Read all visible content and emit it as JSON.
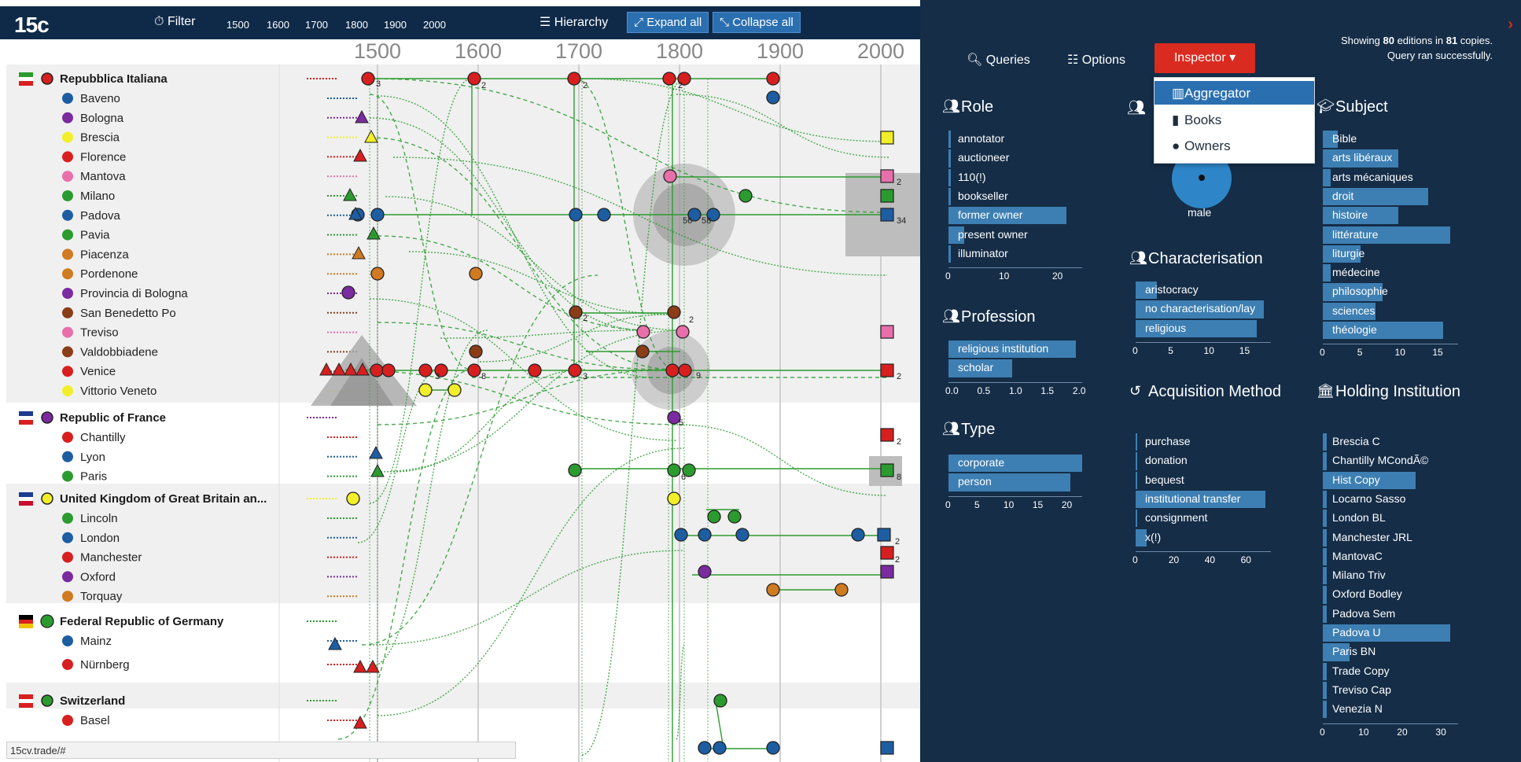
{
  "app": {
    "brand": "15c",
    "filter_label": "Filter",
    "years": [
      "1500",
      "1600",
      "1700",
      "1800",
      "1900",
      "2000"
    ],
    "hierarchy_label": "Hierarchy",
    "expand_all": "Expand all",
    "collapse_all": "Collapse all",
    "status_url": "15cv.trade/#"
  },
  "timeline": {
    "axis_ticks": [
      "1500",
      "1600",
      "1700",
      "1800",
      "1900",
      "2000"
    ]
  },
  "countries": [
    {
      "name": "Repubblica Italiana",
      "color": "#d81f1f",
      "cities": [
        {
          "name": "Baveno",
          "color": "#1d5ea3"
        },
        {
          "name": "Bologna",
          "color": "#7b2aa0"
        },
        {
          "name": "Brescia",
          "color": "#f2ef2a"
        },
        {
          "name": "Florence",
          "color": "#d81f1f"
        },
        {
          "name": "Mantova",
          "color": "#e86faa"
        },
        {
          "name": "Milano",
          "color": "#2c9b2f"
        },
        {
          "name": "Padova",
          "color": "#1d5ea3"
        },
        {
          "name": "Pavia",
          "color": "#2c9b2f"
        },
        {
          "name": "Piacenza",
          "color": "#d07a21"
        },
        {
          "name": "Pordenone",
          "color": "#d07a21"
        },
        {
          "name": "Provincia di Bologna",
          "color": "#7b2aa0"
        },
        {
          "name": "San Benedetto Po",
          "color": "#8a3d17"
        },
        {
          "name": "Treviso",
          "color": "#e86faa"
        },
        {
          "name": "Valdobbiadene",
          "color": "#8a3d17"
        },
        {
          "name": "Venice",
          "color": "#d81f1f"
        },
        {
          "name": "Vittorio Veneto",
          "color": "#f2ef2a"
        }
      ]
    },
    {
      "name": "Republic of France",
      "color": "#7b2aa0",
      "cities": [
        {
          "name": "Chantilly",
          "color": "#d81f1f"
        },
        {
          "name": "Lyon",
          "color": "#1d5ea3"
        },
        {
          "name": "Paris",
          "color": "#2c9b2f"
        }
      ]
    },
    {
      "name": "United Kingdom of Great Britain an...",
      "color": "#f2ef2a",
      "cities": [
        {
          "name": "Lincoln",
          "color": "#2c9b2f"
        },
        {
          "name": "London",
          "color": "#1d5ea3"
        },
        {
          "name": "Manchester",
          "color": "#d81f1f"
        },
        {
          "name": "Oxford",
          "color": "#7b2aa0"
        },
        {
          "name": "Torquay",
          "color": "#d07a21"
        }
      ]
    },
    {
      "name": "Federal Republic of Germany",
      "color": "#2c9b2f",
      "cities": [
        {
          "name": "Mainz",
          "color": "#1d5ea3"
        },
        {
          "name": "Nürnberg",
          "color": "#d81f1f"
        }
      ]
    },
    {
      "name": "Switzerland",
      "color": "#2c9b2f",
      "cities": [
        {
          "name": "Basel",
          "color": "#d81f1f"
        }
      ]
    }
  ],
  "panel": {
    "queries_label": "Queries",
    "options_label": "Options",
    "inspector_label": "Inspector",
    "dropdown": [
      "Aggregator",
      "Books",
      "Owners"
    ],
    "status_line1_pre": "Showing ",
    "status_editions": "80",
    "status_line1_mid": " editions in ",
    "status_copies": "81",
    "status_line1_post": " copies.",
    "status_line2": "Query ran successfully.",
    "male_label": "male"
  },
  "charts": {
    "role": {
      "title": "Role",
      "ticks": [
        "0",
        "10",
        "20"
      ],
      "max": 25,
      "items": [
        {
          "label": "annotator",
          "value": 0.5
        },
        {
          "label": "auctioneer",
          "value": 0.5
        },
        {
          "label": "110(!)",
          "value": 0.5
        },
        {
          "label": "bookseller",
          "value": 0.5
        },
        {
          "label": "former owner",
          "value": 22
        },
        {
          "label": "present owner",
          "value": 3
        },
        {
          "label": "illuminator",
          "value": 0.5
        }
      ]
    },
    "profession": {
      "title": "Profession",
      "ticks": [
        "0.0",
        "0.5",
        "1.0",
        "1.5",
        "2.0"
      ],
      "max": 2.1,
      "items": [
        {
          "label": "religious institution",
          "value": 2
        },
        {
          "label": "scholar",
          "value": 1
        }
      ]
    },
    "type": {
      "title": "Type",
      "ticks": [
        "0",
        "5",
        "10",
        "15",
        "20"
      ],
      "max": 23,
      "items": [
        {
          "label": "corporate",
          "value": 23
        },
        {
          "label": "person",
          "value": 21
        }
      ]
    },
    "characterisation": {
      "title": "Characterisation",
      "ticks": [
        "0",
        "5",
        "10",
        "15"
      ],
      "max": 19,
      "items": [
        {
          "label": "aristocracy",
          "value": 3
        },
        {
          "label": "no characterisation/lay",
          "value": 18
        },
        {
          "label": "religious",
          "value": 17
        }
      ]
    },
    "acquisition": {
      "title": "Acquisition Method",
      "ticks": [
        "0",
        "20",
        "40",
        "60"
      ],
      "max": 75,
      "items": [
        {
          "label": "purchase",
          "value": 1
        },
        {
          "label": "donation",
          "value": 1
        },
        {
          "label": "bequest",
          "value": 1
        },
        {
          "label": "institutional transfer",
          "value": 72
        },
        {
          "label": "consignment",
          "value": 1
        },
        {
          "label": "x(!)",
          "value": 6
        }
      ]
    },
    "subject": {
      "title": "Subject",
      "ticks": [
        "0",
        "5",
        "10",
        "15"
      ],
      "max": 18,
      "items": [
        {
          "label": "Bible",
          "value": 2
        },
        {
          "label": "arts libéraux",
          "value": 10
        },
        {
          "label": "arts mécaniques",
          "value": 1
        },
        {
          "label": "droit",
          "value": 14
        },
        {
          "label": "histoire",
          "value": 10
        },
        {
          "label": "littérature",
          "value": 17
        },
        {
          "label": "liturgie",
          "value": 5
        },
        {
          "label": "médecine",
          "value": 1
        },
        {
          "label": "philosophie",
          "value": 8
        },
        {
          "label": "sciences",
          "value": 7
        },
        {
          "label": "théologie",
          "value": 16
        }
      ]
    },
    "holding": {
      "title": "Holding Institution",
      "ticks": [
        "0",
        "10",
        "20",
        "30"
      ],
      "max": 35,
      "items": [
        {
          "label": "Brescia C",
          "value": 1
        },
        {
          "label": "Chantilly MCondÃ©",
          "value": 1
        },
        {
          "label": "Hist Copy",
          "value": 24
        },
        {
          "label": "Locarno Sasso",
          "value": 1
        },
        {
          "label": "London BL",
          "value": 1
        },
        {
          "label": "Manchester JRL",
          "value": 1
        },
        {
          "label": "MantovaC",
          "value": 1
        },
        {
          "label": "Milano Triv",
          "value": 1
        },
        {
          "label": "Oxford Bodley",
          "value": 1
        },
        {
          "label": "Padova Sem",
          "value": 1
        },
        {
          "label": "Padova U",
          "value": 33
        },
        {
          "label": "Paris BN",
          "value": 7
        },
        {
          "label": "Trade Copy",
          "value": 1
        },
        {
          "label": "Treviso Cap",
          "value": 1
        },
        {
          "label": "Venezia N",
          "value": 1
        }
      ]
    }
  }
}
